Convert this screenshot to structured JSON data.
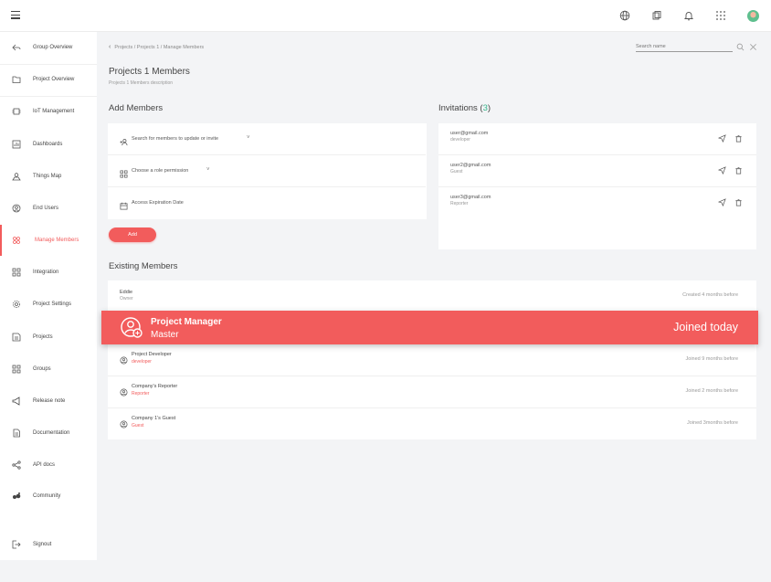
{
  "topbar": {
    "icons": [
      "menu-icon",
      "globe-icon",
      "clipboard-icon",
      "bell-icon",
      "apps-grid-icon",
      "avatar"
    ]
  },
  "sidebar": {
    "items": [
      {
        "label": "Group Overview",
        "icon": "back-arrow-icon"
      },
      {
        "label": "Project Overview",
        "icon": "folder-icon"
      },
      {
        "label": "IoT Management",
        "icon": "iot-icon"
      },
      {
        "label": "Dashboards",
        "icon": "dashboard-icon"
      },
      {
        "label": "Things Map",
        "icon": "map-icon"
      },
      {
        "label": "End Users",
        "icon": "user-circle-icon"
      },
      {
        "label": "Manage Members",
        "icon": "members-icon",
        "active": true
      },
      {
        "label": "Integration",
        "icon": "integration-icon"
      },
      {
        "label": "Project Settings",
        "icon": "gear-icon"
      },
      {
        "label": "Projects",
        "icon": "projects-icon"
      },
      {
        "label": "Groups",
        "icon": "groups-icon"
      },
      {
        "label": "Release note",
        "icon": "megaphone-icon"
      },
      {
        "label": "Documentation",
        "icon": "document-icon"
      },
      {
        "label": "API docs",
        "icon": "share-icon"
      },
      {
        "label": "Community",
        "icon": "community-icon"
      },
      {
        "label": "Signout",
        "icon": "signout-icon"
      }
    ]
  },
  "breadcrumb": "Projects / Projects 1 / Manage Members",
  "search": {
    "placeholder": "Search name"
  },
  "page": {
    "title": "Projects 1 Members",
    "subtitle": "Projects 1 Members description"
  },
  "add_members": {
    "title": "Add Members",
    "search_prompt": "Search for members to update or invite",
    "role_prompt": "Choose a role permission",
    "expiration": "Access Expiration Date",
    "add_button": "Add"
  },
  "invitations": {
    "title": "Invitations (",
    "count": "3",
    "close": ")",
    "items": [
      {
        "email": "user@gmail.com",
        "role": "developer"
      },
      {
        "email": "user2@gmail.com",
        "role": "Guest"
      },
      {
        "email": "user3@gmail.com",
        "role": "Reporter"
      }
    ]
  },
  "existing_members": {
    "title": "Existing Members",
    "items": [
      {
        "name": "Eddie",
        "role": "Owner",
        "time": "Created 4 months before"
      },
      {
        "name": "Project Manager",
        "role": "Master",
        "time": "Joined today",
        "highlighted": true
      },
      {
        "name": "Project Developer",
        "role": "developer",
        "time": "Joined 9 months before"
      },
      {
        "name": "Company's Reporter",
        "role": "Reporter",
        "time": "Joined 2 months before"
      },
      {
        "name": "Company 1's Guest",
        "role": "Guest",
        "time": "Joined 3months before"
      }
    ]
  },
  "colors": {
    "accent": "#f25c5c",
    "count": "#33b58a"
  }
}
